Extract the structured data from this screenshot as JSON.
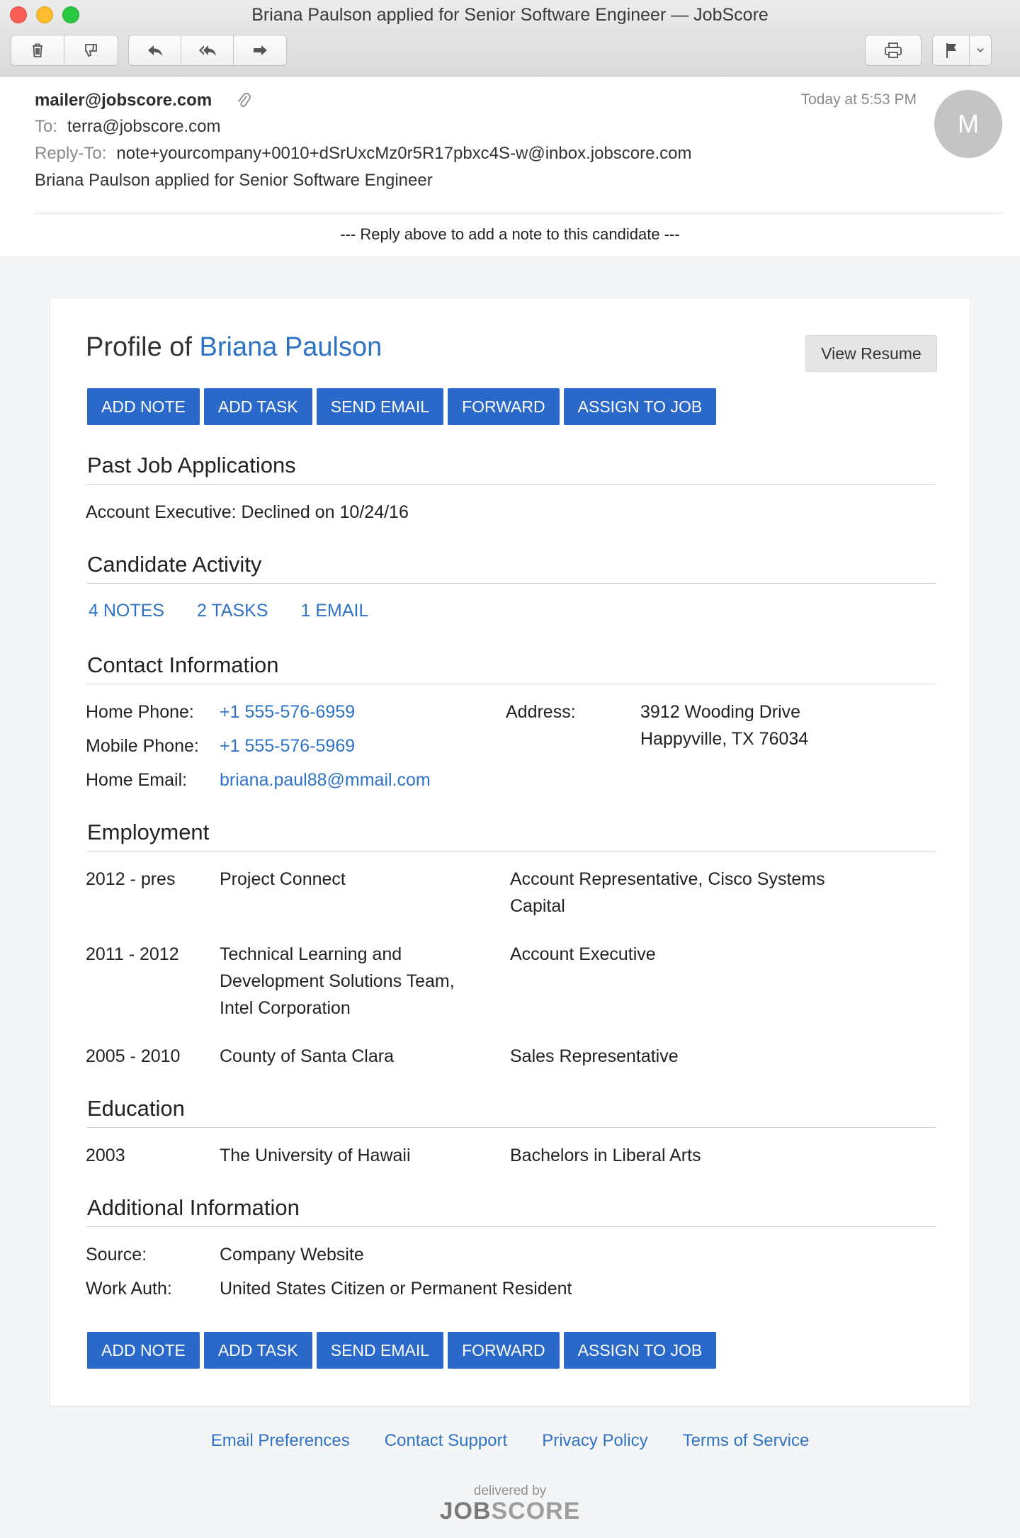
{
  "window": {
    "title": "Briana Paulson applied for Senior Software Engineer — JobScore"
  },
  "toolbar": {
    "icons": [
      "trash-icon",
      "junk-icon",
      "reply-icon",
      "reply-all-icon",
      "forward-icon",
      "print-icon",
      "flag-icon",
      "chevron-down-icon"
    ]
  },
  "email": {
    "from": "mailer@jobscore.com",
    "date": "Today at 5:53 PM",
    "to_label": "To:",
    "to": "terra@jobscore.com",
    "reply_to_label": "Reply-To:",
    "reply_to": "note+yourcompany+0010+dSrUxcMz0r5R17pbxc4S-w@inbox.jobscore.com",
    "subject": "Briana Paulson applied for Senior Software Engineer",
    "avatar_initial": "M",
    "reply_note": "--- Reply above to add a note to this candidate ---"
  },
  "profile": {
    "title_prefix": "Profile of",
    "name": "Briana Paulson",
    "view_resume": "View Resume",
    "actions": [
      "ADD NOTE",
      "ADD TASK",
      "SEND EMAIL",
      "FORWARD",
      "ASSIGN TO JOB"
    ]
  },
  "past_jobs": {
    "title": "Past Job Applications",
    "items": [
      "Account Executive: Declined on 10/24/16"
    ]
  },
  "activity": {
    "title": "Candidate Activity",
    "links": [
      "4 NOTES",
      "2 TASKS",
      "1 EMAIL"
    ]
  },
  "contact": {
    "title": "Contact Information",
    "home_phone_label": "Home Phone:",
    "home_phone": "+1 555-576-6959",
    "mobile_phone_label": "Mobile Phone:",
    "mobile_phone": "+1 555-576-5969",
    "home_email_label": "Home Email:",
    "home_email": "briana.paul88@mmail.com",
    "address_label": "Address:",
    "address_line1": "3912 Wooding Drive",
    "address_line2": "Happyville, TX 76034"
  },
  "employment": {
    "title": "Employment",
    "items": [
      {
        "years": "2012 - pres",
        "company": [
          "Project Connect"
        ],
        "role": [
          "Account Representative, Cisco Systems",
          "Capital"
        ]
      },
      {
        "years": "2011 - 2012",
        "company": [
          "Technical Learning and",
          "Development Solutions Team,",
          "Intel Corporation"
        ],
        "role": [
          "Account Executive"
        ]
      },
      {
        "years": "2005 - 2010",
        "company": [
          "County of Santa Clara"
        ],
        "role": [
          "Sales Representative"
        ]
      }
    ]
  },
  "education": {
    "title": "Education",
    "items": [
      {
        "year": "2003",
        "school": "The University of Hawaii",
        "degree": "Bachelors in Liberal Arts"
      }
    ]
  },
  "additional": {
    "title": "Additional Information",
    "source_label": "Source:",
    "source": "Company Website",
    "work_auth_label": "Work Auth:",
    "work_auth": "United States Citizen or Permanent Resident"
  },
  "footer": {
    "links": [
      "Email Preferences",
      "Contact Support",
      "Privacy Policy",
      "Terms of Service"
    ],
    "delivered_by": "delivered by",
    "logo_job": "JOB",
    "logo_score": "SCORE"
  },
  "colors": {
    "accent": "#2a68c9",
    "link": "#2f73c6"
  }
}
